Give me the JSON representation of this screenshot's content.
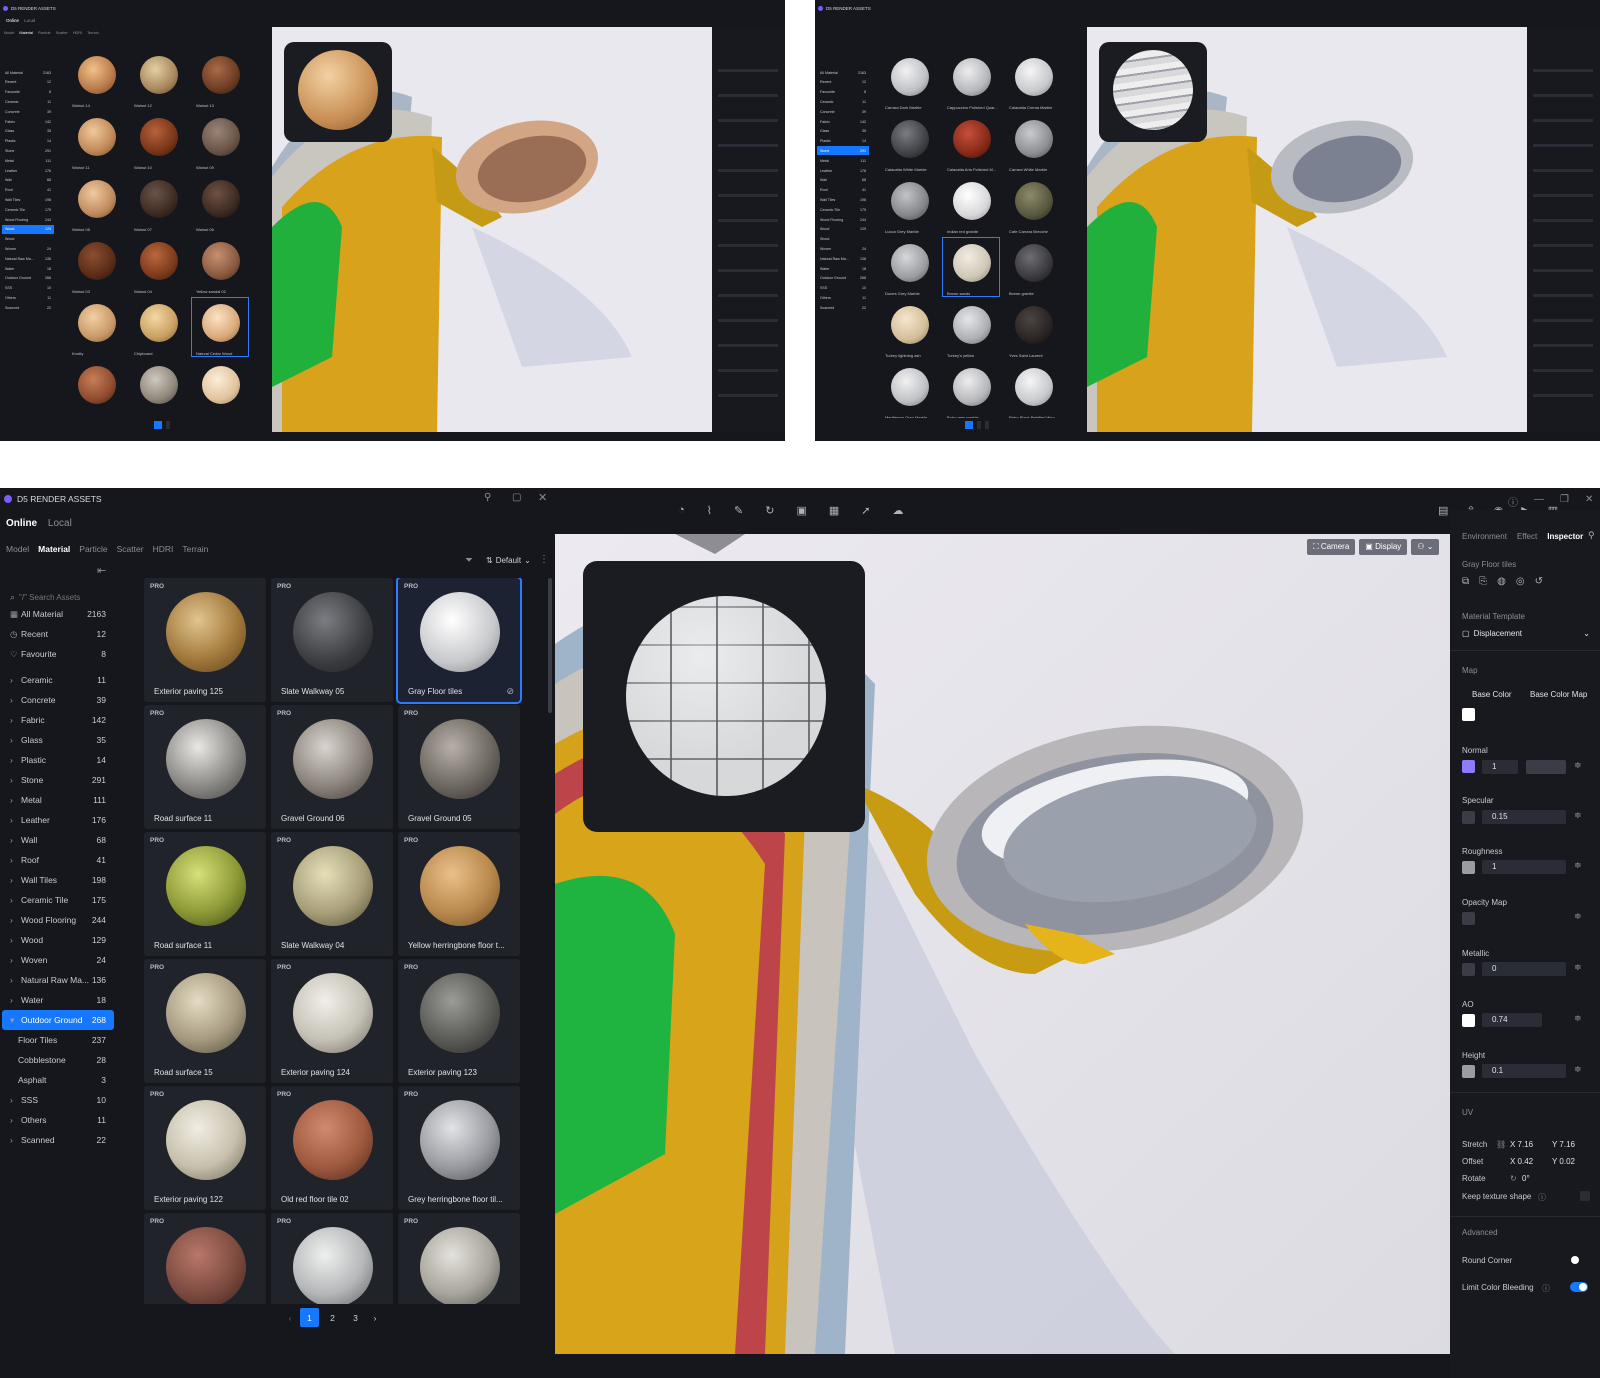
{
  "colors": {
    "accent": "#1677ff",
    "brand": "#7b5cff",
    "panel": "#15171c",
    "tile": "#20232a",
    "toggle": "#1677ff"
  },
  "top_left": {
    "app_title": "D5 RENDER ASSETS",
    "source_tabs": [
      "Online",
      "Local"
    ],
    "asset_tabs": [
      "Model",
      "Material",
      "Particle",
      "Scatter",
      "HDRI",
      "Terrain"
    ],
    "categories": [
      {
        "label": "All Material",
        "count": "2163"
      },
      {
        "label": "Recent",
        "count": "12"
      },
      {
        "label": "Favourite",
        "count": "8"
      },
      {
        "label": "Ceramic",
        "count": "11"
      },
      {
        "label": "Concrete",
        "count": "39"
      },
      {
        "label": "Fabric",
        "count": "142"
      },
      {
        "label": "Glass",
        "count": "35"
      },
      {
        "label": "Plastic",
        "count": "14"
      },
      {
        "label": "Stone",
        "count": "291"
      },
      {
        "label": "Metal",
        "count": "111"
      },
      {
        "label": "Leather",
        "count": "176"
      },
      {
        "label": "Wall",
        "count": "68"
      },
      {
        "label": "Roof",
        "count": "41"
      },
      {
        "label": "Wall Tiles",
        "count": "198"
      },
      {
        "label": "Ceramic Tile",
        "count": "175"
      },
      {
        "label": "Wood Flooring",
        "count": "244"
      },
      {
        "label": "Wood",
        "count": "129"
      },
      {
        "label": "Wood",
        "count": ""
      },
      {
        "label": "Woven",
        "count": "24"
      },
      {
        "label": "Natural Raw Ma...",
        "count": "136"
      },
      {
        "label": "Water",
        "count": "18"
      },
      {
        "label": "Outdoor Ground",
        "count": "268"
      },
      {
        "label": "SSS",
        "count": "10"
      },
      {
        "label": "Others",
        "count": "11"
      },
      {
        "label": "Scanned",
        "count": "22"
      }
    ],
    "materials": [
      "Walnut 14",
      "Walnut 12",
      "Walnut 13",
      "Walnut 11",
      "Walnut 10",
      "Walnut 09",
      "Walnut 08",
      "Walnut 07",
      "Walnut 06",
      "Walnut 03",
      "Walnut 04",
      "Yellow sandal 02",
      "Knotty",
      "Chipboard",
      "Natural Cedar Wood",
      "",
      "",
      ""
    ]
  },
  "top_right": {
    "materials": [
      "Carrara Dark Marble",
      "Cappuccino Polished Quar...",
      "Calacatta Crema Marble",
      "Calacatta White Marble",
      "Calacatta Aria Polished M...",
      "Carrara White Marble",
      "Lucca Grey Marble",
      "Indian red granite",
      "Cafe Carrara Brecche",
      "Dunes Grey Marble",
      "Brown sands",
      "Brown granite",
      "Turkey lightning ash",
      "Turkey's yellow",
      "Yves Saint Laurent",
      "Mediterran Grey Marble",
      "Boho grey marble",
      "Retro Black Petrified Woo...",
      "",
      "",
      ""
    ]
  },
  "main": {
    "app_title": "D5 RENDER ASSETS",
    "source_tabs": {
      "online": "Online",
      "local": "Local"
    },
    "asset_tabs": [
      {
        "label": "Model"
      },
      {
        "label": "Material"
      },
      {
        "label": "Particle"
      },
      {
        "label": "Scatter"
      },
      {
        "label": "HDRI"
      },
      {
        "label": "Terrain"
      }
    ],
    "search_placeholder": "\"/\" Search Assets",
    "sort_label": "Default",
    "categories": [
      {
        "label": "All Material",
        "count": "2163"
      },
      {
        "label": "Recent",
        "count": "12"
      },
      {
        "label": "Favourite",
        "count": "8"
      },
      {
        "label": "Ceramic",
        "count": "11"
      },
      {
        "label": "Concrete",
        "count": "39"
      },
      {
        "label": "Fabric",
        "count": "142"
      },
      {
        "label": "Glass",
        "count": "35"
      },
      {
        "label": "Plastic",
        "count": "14"
      },
      {
        "label": "Stone",
        "count": "291"
      },
      {
        "label": "Metal",
        "count": "111"
      },
      {
        "label": "Leather",
        "count": "176"
      },
      {
        "label": "Wall",
        "count": "68"
      },
      {
        "label": "Roof",
        "count": "41"
      },
      {
        "label": "Wall Tiles",
        "count": "198"
      },
      {
        "label": "Ceramic Tile",
        "count": "175"
      },
      {
        "label": "Wood Flooring",
        "count": "244"
      },
      {
        "label": "Wood",
        "count": "129"
      },
      {
        "label": "Woven",
        "count": "24"
      },
      {
        "label": "Natural Raw Ma...",
        "count": "136"
      },
      {
        "label": "Water",
        "count": "18"
      },
      {
        "label": "Outdoor Ground",
        "count": "268"
      },
      {
        "label": "Floor Tiles",
        "count": "237"
      },
      {
        "label": "Cobblestone",
        "count": "28"
      },
      {
        "label": "Asphalt",
        "count": "3"
      },
      {
        "label": "SSS",
        "count": "10"
      },
      {
        "label": "Others",
        "count": "11"
      },
      {
        "label": "Scanned",
        "count": "22"
      }
    ],
    "materials": [
      {
        "name": "Exterior paving 125",
        "tag": "PRO"
      },
      {
        "name": "Slate Walkway 05",
        "tag": "PRO"
      },
      {
        "name": "Gray Floor tiles",
        "tag": "PRO"
      },
      {
        "name": "Road surface 11",
        "tag": "PRO"
      },
      {
        "name": "Gravel Ground 06",
        "tag": "PRO"
      },
      {
        "name": "Gravel Ground 05",
        "tag": "PRO"
      },
      {
        "name": "Road surface 11",
        "tag": "PRO"
      },
      {
        "name": "Slate Walkway 04",
        "tag": "PRO"
      },
      {
        "name": "Yellow herringbone floor t...",
        "tag": "PRO"
      },
      {
        "name": "Road surface 15",
        "tag": "PRO"
      },
      {
        "name": "Exterior paving 124",
        "tag": "PRO"
      },
      {
        "name": "Exterior paving 123",
        "tag": "PRO"
      },
      {
        "name": "Exterior paving 122",
        "tag": "PRO"
      },
      {
        "name": "Old red floor tile 02",
        "tag": "PRO"
      },
      {
        "name": "Grey herringbone floor til...",
        "tag": "PRO"
      },
      {
        "name": "",
        "tag": "PRO"
      },
      {
        "name": "",
        "tag": "PRO"
      },
      {
        "name": "",
        "tag": "PRO"
      }
    ],
    "pages": [
      "1",
      "2",
      "3"
    ],
    "viewport_buttons": {
      "camera": "Camera",
      "display": "Display"
    },
    "inspector_tabs": {
      "environment": "Environment",
      "effect": "Effect",
      "inspector": "Inspector"
    },
    "material_name": "Gray Floor tiles",
    "template_label": "Material Template",
    "template_value": "Displacement",
    "map_section": "Map",
    "base_color": "Base Color",
    "base_color_map": "Base Color Map",
    "normal": {
      "label": "Normal",
      "value": "1"
    },
    "specular": {
      "label": "Specular",
      "value": "0.15"
    },
    "roughness": {
      "label": "Roughness",
      "value": "1"
    },
    "opacity": {
      "label": "Opacity Map"
    },
    "metallic": {
      "label": "Metallic",
      "value": "0"
    },
    "ao": {
      "label": "AO",
      "value": "0.74"
    },
    "height": {
      "label": "Height",
      "value": "0.1"
    },
    "uv_section": "UV",
    "stretch": {
      "label": "Stretch",
      "x": "X 7.16",
      "y": "Y 7.16"
    },
    "offset": {
      "label": "Offset",
      "x": "X 0.42",
      "y": "Y 0.02"
    },
    "rotate": {
      "label": "Rotate",
      "value": "0°"
    },
    "keep_texture": "Keep texture shape",
    "advanced_section": "Advanced",
    "round_corner": "Round Corner",
    "limit_color": "Limit Color Bleeding"
  }
}
